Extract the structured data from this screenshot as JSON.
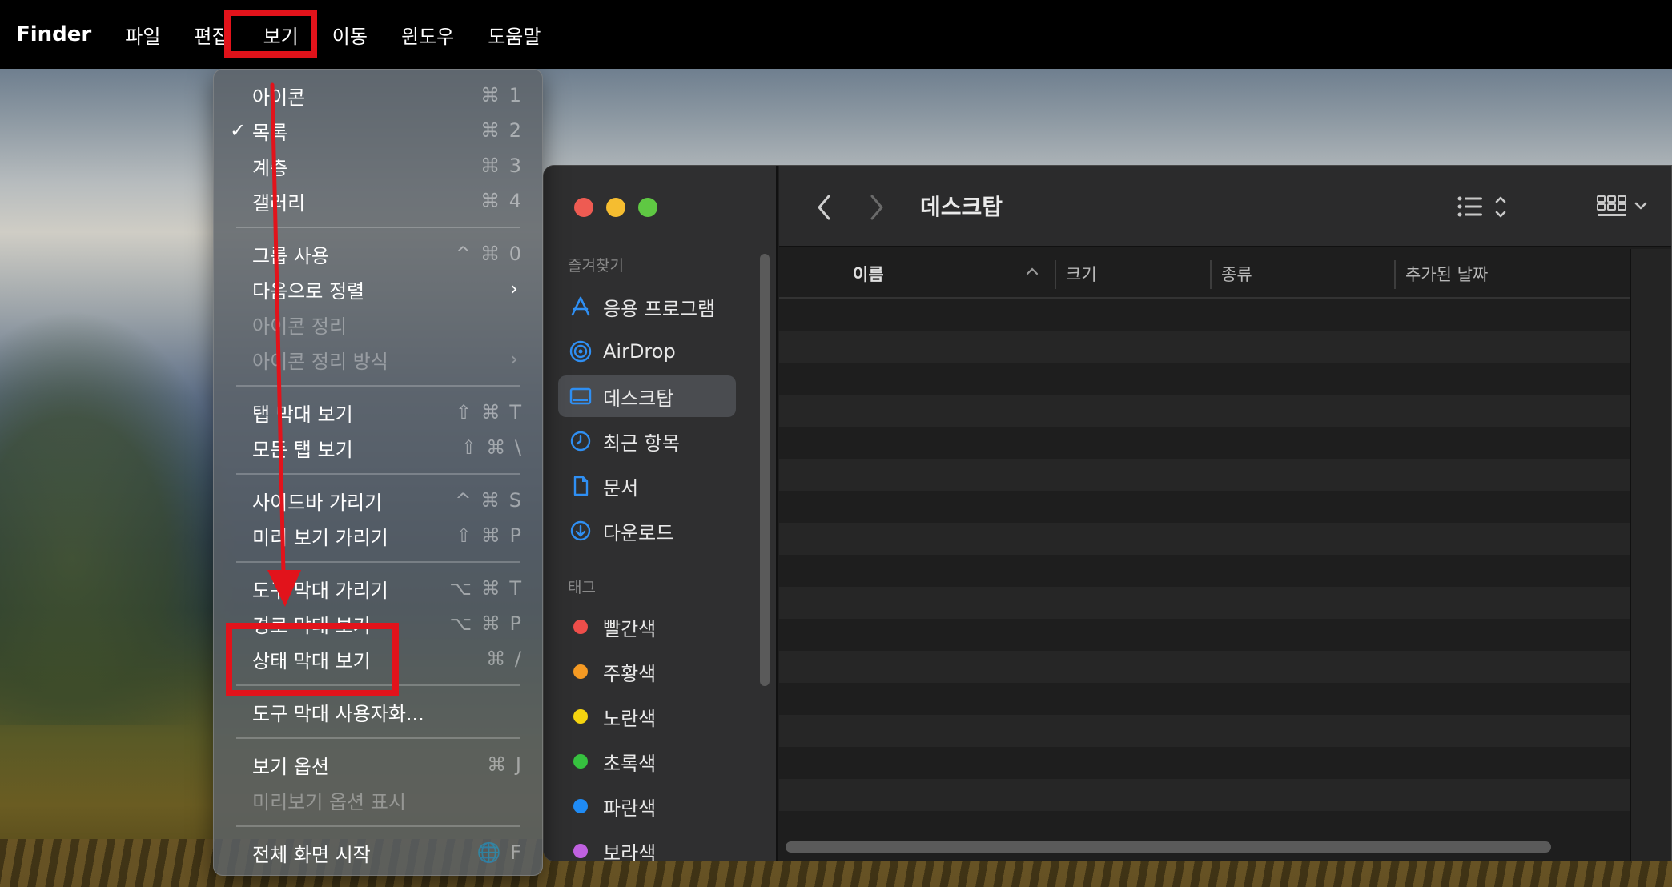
{
  "menubar": {
    "app": "Finder",
    "items": [
      "파일",
      "편집",
      "보기",
      "이동",
      "윈도우",
      "도움말"
    ]
  },
  "view_menu": {
    "items": [
      {
        "label": "아이콘",
        "shortcut": "⌘ 1",
        "checked": false,
        "disabled": false
      },
      {
        "label": "목록",
        "shortcut": "⌘ 2",
        "checked": true,
        "disabled": false
      },
      {
        "label": "계층",
        "shortcut": "⌘ 3",
        "checked": false,
        "disabled": false
      },
      {
        "label": "갤러리",
        "shortcut": "⌘ 4",
        "checked": false,
        "disabled": false
      },
      {
        "label": "그룹 사용",
        "shortcut": "^ ⌘ 0",
        "checked": false,
        "disabled": false
      },
      {
        "label": "다음으로 정렬",
        "submenu": true,
        "disabled": false
      },
      {
        "label": "아이콘 정리",
        "disabled": true
      },
      {
        "label": "아이콘 정리 방식",
        "submenu": true,
        "disabled": true
      },
      {
        "label": "탭 막대 보기",
        "shortcut": "⇧ ⌘ T",
        "disabled": false
      },
      {
        "label": "모든 탭 보기",
        "shortcut": "⇧ ⌘ \\",
        "disabled": false
      },
      {
        "label": "사이드바 가리기",
        "shortcut": "^ ⌘ S",
        "disabled": false
      },
      {
        "label": "미리 보기 가리기",
        "shortcut": "⇧ ⌘ P",
        "disabled": false
      },
      {
        "label": "도구 막대 가리기",
        "shortcut": "⌥ ⌘ T",
        "disabled": false
      },
      {
        "label": "경로 막대 보기",
        "shortcut": "⌥ ⌘ P",
        "disabled": false
      },
      {
        "label": "상태 막대 보기",
        "shortcut": "⌘ /",
        "disabled": false
      },
      {
        "label": "도구 막대 사용자화...",
        "disabled": false
      },
      {
        "label": "보기 옵션",
        "shortcut": "⌘ J",
        "disabled": false
      },
      {
        "label": "미리보기 옵션 표시",
        "disabled": true
      },
      {
        "label": "전체 화면 시작",
        "shortcut": "🌐 F",
        "disabled": false
      }
    ]
  },
  "finder": {
    "title": "데스크탑",
    "sidebar": {
      "favorites_header": "즐겨찾기",
      "favorites": [
        {
          "label": "응용 프로그램",
          "icon": "applications-icon"
        },
        {
          "label": "AirDrop",
          "icon": "airdrop-icon"
        },
        {
          "label": "데스크탑",
          "icon": "desktop-icon",
          "selected": true
        },
        {
          "label": "최근 항목",
          "icon": "clock-icon"
        },
        {
          "label": "문서",
          "icon": "document-icon"
        },
        {
          "label": "다운로드",
          "icon": "download-icon"
        }
      ],
      "tags_header": "태그",
      "tags": [
        {
          "label": "빨간색",
          "color": "#ee4e4a"
        },
        {
          "label": "주황색",
          "color": "#f59a23"
        },
        {
          "label": "노란색",
          "color": "#f5d40f"
        },
        {
          "label": "초록색",
          "color": "#36c13f"
        },
        {
          "label": "파란색",
          "color": "#1f8bf5"
        },
        {
          "label": "보라색",
          "color": "#c061e0"
        }
      ]
    },
    "columns": [
      "이름",
      "크기",
      "종류",
      "추가된 날짜"
    ]
  },
  "colors": {
    "highlight": "#e2131b",
    "accent": "#2f8ff3"
  }
}
